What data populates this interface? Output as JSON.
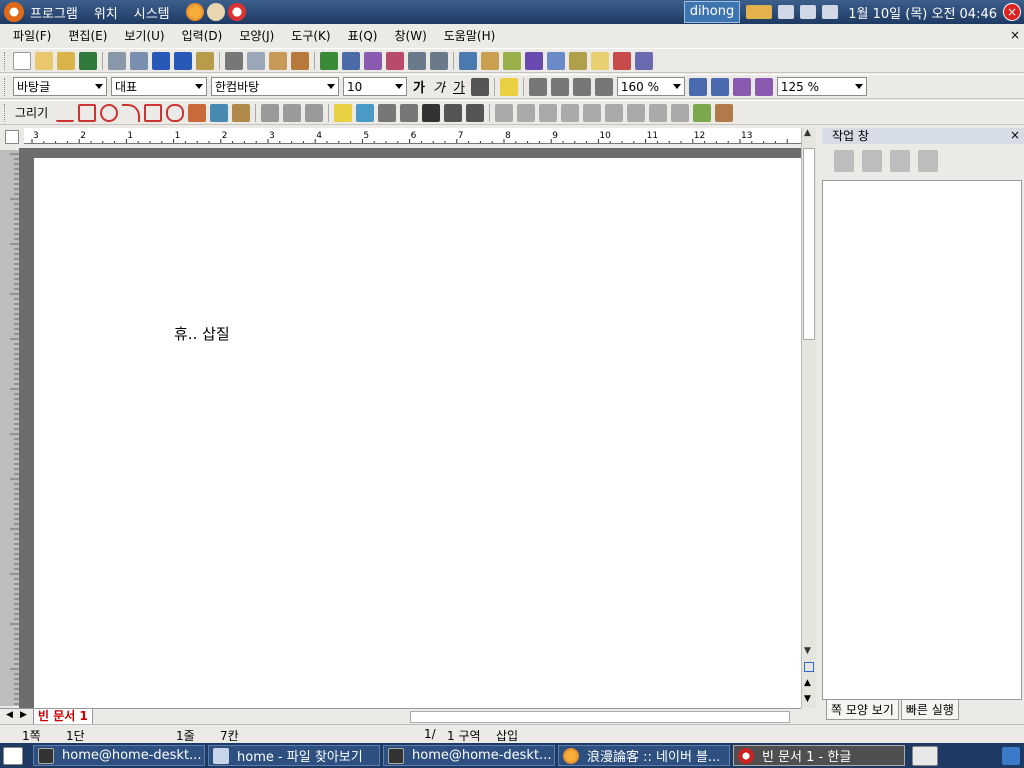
{
  "top_panel": {
    "menus": [
      "프로그램",
      "위치",
      "시스템"
    ],
    "user": "dihong",
    "clock": "1월 10일 (목) 오전 04:46"
  },
  "menubar": {
    "items": [
      "파일(F)",
      "편집(E)",
      "보기(U)",
      "입력(D)",
      "모양(J)",
      "도구(K)",
      "표(Q)",
      "창(W)",
      "도움말(H)"
    ],
    "close_label": "×"
  },
  "format_bar": {
    "style": "바탕글",
    "language": "대표",
    "font": "한컴바탕",
    "size": "10",
    "bold_label": "가",
    "italic_label": "가",
    "underline_label": "가",
    "line_spacing": "160 %",
    "zoom": "125 %"
  },
  "drawing_bar": {
    "label": "그리기"
  },
  "ruler": {
    "ticks": [
      "3",
      "2",
      "1",
      "1",
      "2",
      "3",
      "4",
      "5",
      "6",
      "7",
      "8",
      "9",
      "10",
      "11",
      "12",
      "13"
    ]
  },
  "document": {
    "text": "휴.. 삽질"
  },
  "task_pane": {
    "title": "작업 창",
    "tabs": [
      "쪽 모양 보기",
      "빠른 실행"
    ]
  },
  "tabbar": {
    "doc_tab": "빈 문서 1"
  },
  "status": {
    "page": "1쪽",
    "column": "1단",
    "line": "1줄",
    "col_pos": "7칸",
    "page_count": "1/",
    "section": "1 구역",
    "mode": "삽입"
  },
  "taskbar": {
    "tasks": [
      "home@home-deskt...",
      "home - 파일 찾아보기",
      "home@home-deskt...",
      "浪漫論客 :: 네이버 블...",
      "빈 문서 1 - 한글"
    ]
  }
}
